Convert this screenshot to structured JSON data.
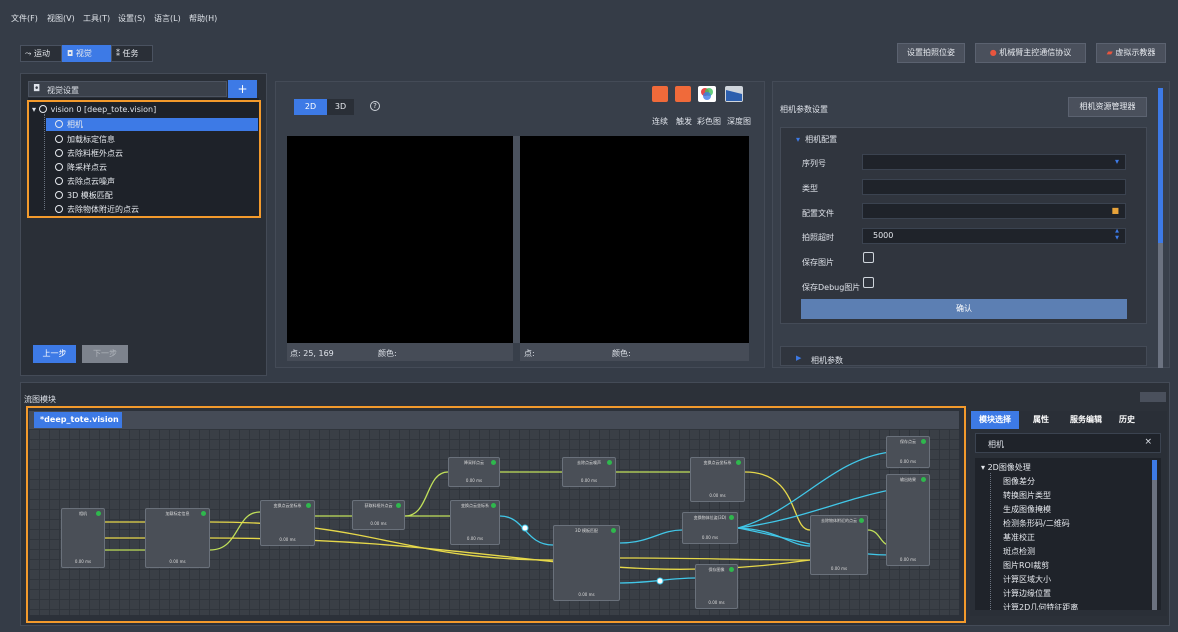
{
  "menu": [
    "文件(F)",
    "视图(V)",
    "工具(T)",
    "设置(S)",
    "语言(L)",
    "帮助(H)"
  ],
  "toolbar": {
    "tabs": [
      "运动",
      "视觉",
      "任务"
    ],
    "right": [
      "设置拍照位姿",
      "机械臂主控通信协议",
      "虚拟示教器"
    ]
  },
  "vision_settings": {
    "title": "视觉设置",
    "add": "+",
    "tree_root": "vision 0 [deep_tote.vision]",
    "tree_items": [
      "相机",
      "加载标定信息",
      "去除料框外点云",
      "降采样点云",
      "去除点云噪声",
      "3D 模板匹配",
      "去除物体附近的点云"
    ],
    "prev": "上一步",
    "next": "下一步"
  },
  "viewer": {
    "tab2d": "2D",
    "tab3d": "3D",
    "help": "?",
    "icons": [
      "连续",
      "触发",
      "彩色图",
      "深度图"
    ],
    "left_point": "点:  25, 169",
    "left_color": "颜色:",
    "right_point": "点:",
    "right_color": "颜色:"
  },
  "camera_params": {
    "title": "相机参数设置",
    "manager": "相机资源管理器",
    "section": "相机配置",
    "fields": [
      "序列号",
      "类型",
      "配置文件",
      "拍照超时",
      "保存图片",
      "保存Debug图片"
    ],
    "timeout_value": "5000",
    "confirm": "确认",
    "section2": "相机参数"
  },
  "flow": {
    "title": "流图模块",
    "tab": "*deep_tote.vision",
    "nodes": [
      {
        "title": "相机",
        "ports": [
          "Image(彩色)",
          "Image(深度)",
          "点云"
        ],
        "ms": "0.00 ms"
      },
      {
        "title": "加载标定信息",
        "ports": [
          "Image(彩色)",
          "Image(深度)",
          "点云"
        ],
        "ms": "0.00 ms"
      },
      {
        "title": "变换点云坐标系",
        "ports": [
          "点云"
        ],
        "ms": "0.00 ms"
      },
      {
        "title": "获取料框外点云",
        "ports": [
          "点云"
        ],
        "ms": "0.00 ms"
      },
      {
        "title": "降采样点云",
        "ports": [
          "点云"
        ],
        "ms": "0.00 ms"
      },
      {
        "title": "去除点云噪声",
        "ports": [
          "点云"
        ],
        "ms": "0.00 ms"
      },
      {
        "title": "变换点云坐标系",
        "ports": [
          "点云"
        ],
        "ms": "0.00 ms"
      },
      {
        "title": "变换点云坐标系",
        "ports": [
          "点云"
        ],
        "ms": "0.00 ms"
      },
      {
        "title": "3D 模板匹配",
        "ports": [
          "点云",
          "Image(彩色)",
          "位姿列表",
          "Image(彩色)"
        ],
        "ms": "0.00 ms"
      },
      {
        "title": "变换物体位姿(3D)",
        "ports": [
          "位姿列表"
        ],
        "ms": "0.00 ms"
      },
      {
        "title": "保存图像",
        "ports": [
          "图像"
        ],
        "ms": "0.00 ms"
      },
      {
        "title": "去除物体附近的点云",
        "ports": [
          "点云",
          "位姿列表"
        ],
        "ms": "0.00 ms"
      },
      {
        "title": "保存点云",
        "ports": [
          "点云"
        ],
        "ms": "0.00 ms"
      },
      {
        "title": "输出结果",
        "ports": [
          "位姿列表"
        ],
        "ms": "0.00 ms"
      }
    ]
  },
  "right_panel": {
    "tabs": [
      "模块选择",
      "属性",
      "服务编辑",
      "历史"
    ],
    "search": "相机",
    "close": "×",
    "group": "2D图像处理",
    "items": [
      "图像差分",
      "转换图片类型",
      "生成图像掩模",
      "检测条形码/二维码",
      "基准校正",
      "斑点检测",
      "图片ROI裁剪",
      "计算区域大小",
      "计算边缘位置",
      "计算2D几何特征距离"
    ]
  }
}
